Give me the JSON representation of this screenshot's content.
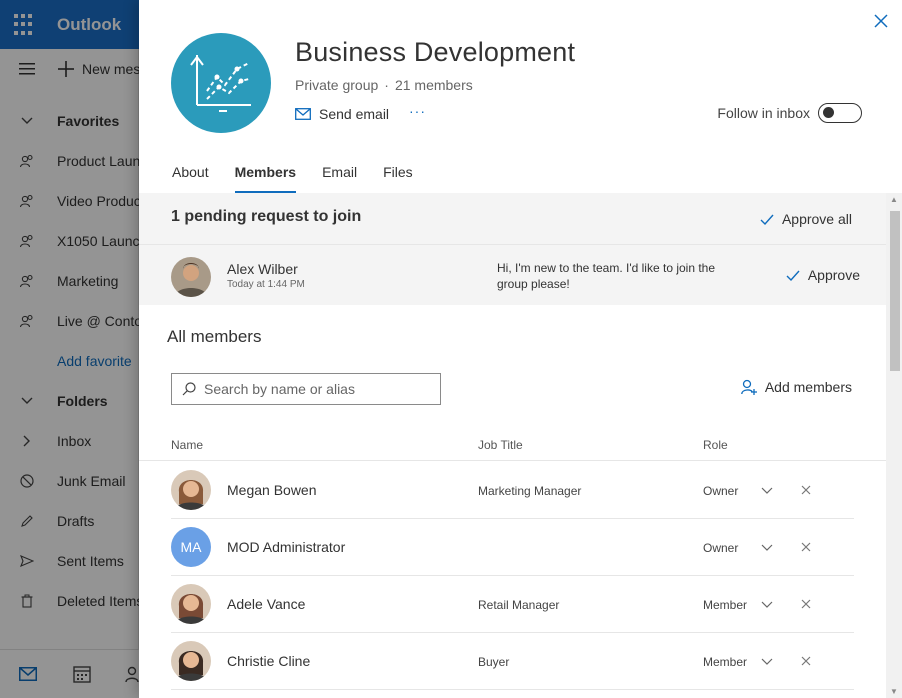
{
  "app": {
    "brand": "Outlook",
    "new_message_label": "New message",
    "nav": [
      {
        "label": "Favorites",
        "icon": "chevron-down-icon",
        "bold": true
      },
      {
        "label": "Product Launch",
        "icon": "group-icon"
      },
      {
        "label": "Video Production",
        "icon": "group-icon"
      },
      {
        "label": "X1050 Launch",
        "icon": "group-icon"
      },
      {
        "label": "Marketing",
        "icon": "group-icon"
      },
      {
        "label": "Live @ Contoso",
        "icon": "group-icon"
      },
      {
        "label": "Add favorite",
        "icon": "",
        "link": true
      },
      {
        "label": "Folders",
        "icon": "chevron-down-icon",
        "bold": true
      },
      {
        "label": "Inbox",
        "icon": "chevron-right-icon"
      },
      {
        "label": "Junk Email",
        "icon": "block-icon"
      },
      {
        "label": "Drafts",
        "icon": "pencil-icon"
      },
      {
        "label": "Sent Items",
        "icon": "send-icon"
      },
      {
        "label": "Deleted Items",
        "icon": "trash-icon"
      }
    ]
  },
  "panel": {
    "group_name": "Business Development",
    "privacy": "Private group",
    "member_count": "21 members",
    "send_email_label": "Send email",
    "more_label": "···",
    "follow_label": "Follow in inbox",
    "follow_on": false,
    "tabs": [
      {
        "label": "About",
        "active": false
      },
      {
        "label": "Members",
        "active": true
      },
      {
        "label": "Email",
        "active": false
      },
      {
        "label": "Files",
        "active": false
      }
    ],
    "pending": {
      "title": "1 pending request to join",
      "approve_all_label": "Approve all",
      "request": {
        "name": "Alex Wilber",
        "time": "Today at 1:44 PM",
        "message": "Hi, I'm new to the team. I'd like to join the group please!",
        "approve_label": "Approve"
      }
    },
    "members_heading": "All members",
    "search_placeholder": "Search by name or alias",
    "add_members_label": "Add members",
    "columns": {
      "name": "Name",
      "job_title": "Job Title",
      "role": "Role"
    },
    "members": [
      {
        "name": "Megan Bowen",
        "job_title": "Marketing Manager",
        "role": "Owner",
        "avatar_color": "#8a5a3a",
        "initials": ""
      },
      {
        "name": "MOD Administrator",
        "job_title": "",
        "role": "Owner",
        "avatar_color": "#6aa0e6",
        "initials": "MA"
      },
      {
        "name": "Adele Vance",
        "job_title": "Retail Manager",
        "role": "Member",
        "avatar_color": "#7a4a35",
        "initials": ""
      },
      {
        "name": "Christie Cline",
        "job_title": "Buyer",
        "role": "Member",
        "avatar_color": "#3a2a22",
        "initials": ""
      }
    ]
  },
  "colors": {
    "accent": "#0f6cbd",
    "group_avatar": "#2b9bbb",
    "header_blue": "#1a6fc9"
  }
}
